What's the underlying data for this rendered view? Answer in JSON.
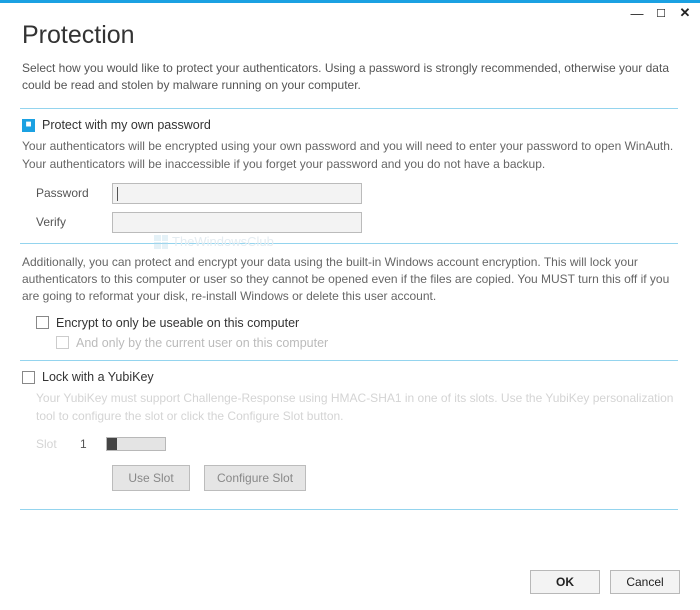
{
  "window": {
    "title": "Protection",
    "intro": "Select how you would like to protect your authenticators. Using a password is strongly recommended, otherwise your data could be read and stolen by malware running on your computer."
  },
  "watermark": "TheWindowsClub",
  "password_section": {
    "check_label": "Protect with my own password",
    "checked": true,
    "desc": "Your authenticators will be encrypted using your own password and you will need to enter your password to open WinAuth. Your authenticators will be inaccessible if you forget your password and you do not have a backup.",
    "password_label": "Password",
    "verify_label": "Verify",
    "password_value": "",
    "verify_value": ""
  },
  "encrypt_section": {
    "desc": "Additionally, you can protect and encrypt your data using the built-in Windows account encryption. This will lock your authenticators to this computer or user so they cannot be opened even if the files are copied. You MUST turn this off if you are going to reformat your disk, re-install Windows or delete this user account.",
    "check1_label": "Encrypt to only be useable on this computer",
    "check1_checked": false,
    "check2_label": "And only by the current user on this computer",
    "check2_checked": false
  },
  "yubi_section": {
    "check_label": "Lock with a YubiKey",
    "checked": false,
    "desc": "Your YubiKey must support Challenge-Response using HMAC-SHA1 in one of its slots. Use the YubiKey personalization tool to configure the slot or click the Configure Slot button.",
    "slot_label": "Slot",
    "slot_value": "1",
    "use_slot_btn": "Use Slot",
    "configure_slot_btn": "Configure Slot"
  },
  "footer": {
    "ok": "OK",
    "cancel": "Cancel"
  }
}
